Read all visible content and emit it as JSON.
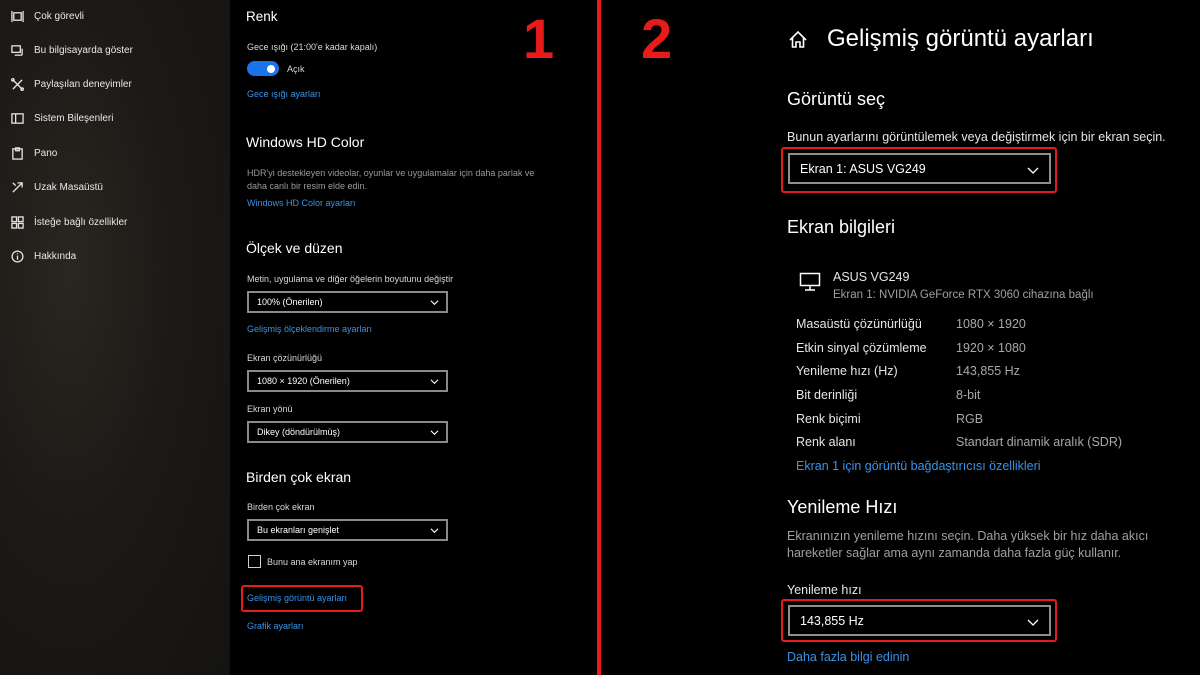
{
  "sidebar": {
    "items": [
      {
        "label": "Çok görevli",
        "icon": "multitasking-icon"
      },
      {
        "label": "Bu bilgisayarda göster",
        "icon": "project-icon"
      },
      {
        "label": "Paylaşılan deneyimler",
        "icon": "shared-experiences-icon"
      },
      {
        "label": "Sistem Bileşenleri",
        "icon": "system-components-icon"
      },
      {
        "label": "Pano",
        "icon": "clipboard-icon"
      },
      {
        "label": "Uzak Masaüstü",
        "icon": "remote-desktop-icon"
      },
      {
        "label": "İsteğe bağlı özellikler",
        "icon": "optional-features-icon"
      },
      {
        "label": "Hakkında",
        "icon": "info-icon"
      }
    ]
  },
  "panel1": {
    "color": {
      "heading": "Renk",
      "night_light_label": "Gece ışığı (21:00'e kadar kapalı)",
      "toggle_state": "Açık",
      "night_light_settings_link": "Gece ışığı ayarları"
    },
    "hd_color": {
      "heading": "Windows HD Color",
      "description_line1": "HDR'yi destekleyen videolar, oyunlar ve uygulamalar için daha parlak ve",
      "description_line2": "daha canlı bir resim elde edin.",
      "settings_link": "Windows HD Color ayarları"
    },
    "scale": {
      "heading": "Ölçek ve düzen",
      "size_label": "Metin, uygulama ve diğer öğelerin boyutunu değiştir",
      "size_value": "100% (Önerilen)",
      "advanced_scale_link": "Gelişmiş ölçeklendirme ayarları",
      "resolution_label": "Ekran çözünürlüğü",
      "resolution_value": "1080 × 1920 (Önerilen)",
      "orientation_label": "Ekran yönü",
      "orientation_value": "Dikey (döndürülmüş)"
    },
    "multi": {
      "heading": "Birden çok ekran",
      "label": "Birden çok ekran",
      "value": "Bu ekranları genişlet",
      "checkbox_label": "Bunu ana ekranım yap",
      "advanced_display_link": "Gelişmiş görüntü ayarları",
      "graphics_link": "Grafik ayarları"
    }
  },
  "markers": {
    "one": "1",
    "two": "2",
    "accent_color": "#e81b1b"
  },
  "panel2": {
    "title": "Gelişmiş görüntü ayarları",
    "select_display": {
      "heading": "Görüntü seç",
      "description": "Bunun ayarlarını görüntülemek veya değiştirmek için bir ekran seçin.",
      "value": "Ekran 1: ASUS VG249"
    },
    "display_info": {
      "heading": "Ekran bilgileri",
      "monitor_name": "ASUS VG249",
      "monitor_sub": "Ekran 1: NVIDIA GeForce RTX 3060 cihazına bağlı",
      "rows": [
        {
          "key": "Masaüstü çözünürlüğü",
          "value": "1080 × 1920"
        },
        {
          "key": "Etkin sinyal çözümleme",
          "value": "1920 × 1080"
        },
        {
          "key": "Yenileme hızı (Hz)",
          "value": "143,855 Hz"
        },
        {
          "key": "Bit derinliği",
          "value": "8-bit"
        },
        {
          "key": "Renk biçimi",
          "value": "RGB"
        },
        {
          "key": "Renk alanı",
          "value": "Standart dinamik aralık (SDR)"
        }
      ],
      "adapter_link": "Ekran 1 için görüntü bağdaştırıcısı özellikleri"
    },
    "refresh": {
      "heading": "Yenileme Hızı",
      "description_line1": "Ekranınızın yenileme hızını seçin. Daha yüksek bir hız daha akıcı",
      "description_line2": "hareketler sağlar ama aynı zamanda daha fazla güç kullanır.",
      "label": "Yenileme hızı",
      "value": "143,855 Hz",
      "more_info_link": "Daha fazla bilgi edinin"
    }
  }
}
